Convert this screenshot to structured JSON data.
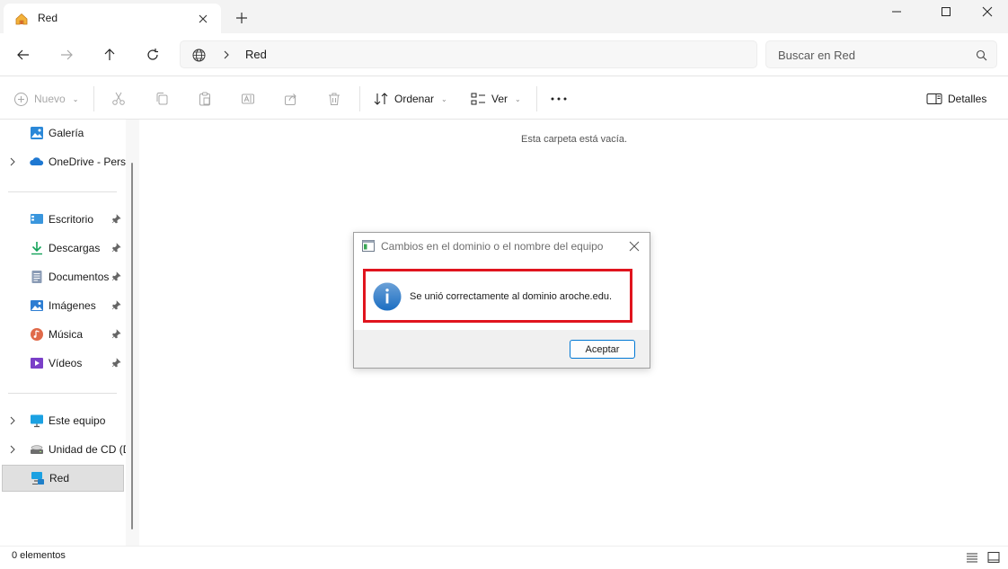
{
  "tab": {
    "title": "Red",
    "icon": "home-icon"
  },
  "window_controls": {
    "minimize": "minimize-icon",
    "maximize": "maximize-icon",
    "close": "close-icon"
  },
  "address": {
    "location": "Red",
    "icon": "globe-icon"
  },
  "search": {
    "placeholder": "Buscar en Red"
  },
  "commands": {
    "new_label": "Nuevo",
    "sort_label": "Ordenar",
    "view_label": "Ver",
    "details_label": "Detalles"
  },
  "sidebar": {
    "items": [
      {
        "label": "Galería",
        "icon": "gallery-icon"
      },
      {
        "label": "OneDrive - Personal",
        "icon": "onedrive-cloud-icon"
      },
      {
        "label": "Escritorio",
        "icon": "desktop-icon"
      },
      {
        "label": "Descargas",
        "icon": "downloads-icon"
      },
      {
        "label": "Documentos",
        "icon": "documents-icon"
      },
      {
        "label": "Imágenes",
        "icon": "pictures-icon"
      },
      {
        "label": "Música",
        "icon": "music-icon"
      },
      {
        "label": "Vídeos",
        "icon": "videos-icon"
      },
      {
        "label": "Este equipo",
        "icon": "this-pc-icon"
      },
      {
        "label": "Unidad de CD (D:)",
        "icon": "cd-drive-icon"
      },
      {
        "label": "Red",
        "icon": "network-icon"
      }
    ]
  },
  "content": {
    "empty_message": "Esta carpeta está vacía."
  },
  "status": {
    "item_count": "0 elementos"
  },
  "dialog": {
    "title": "Cambios en el dominio o el nombre del equipo",
    "message": "Se unió correctamente al dominio aroche.edu.",
    "ok_label": "Aceptar",
    "highlight_color": "#e0141e"
  },
  "colors": {
    "accent": "#0078d4",
    "info_icon": "#1b6ec2"
  }
}
